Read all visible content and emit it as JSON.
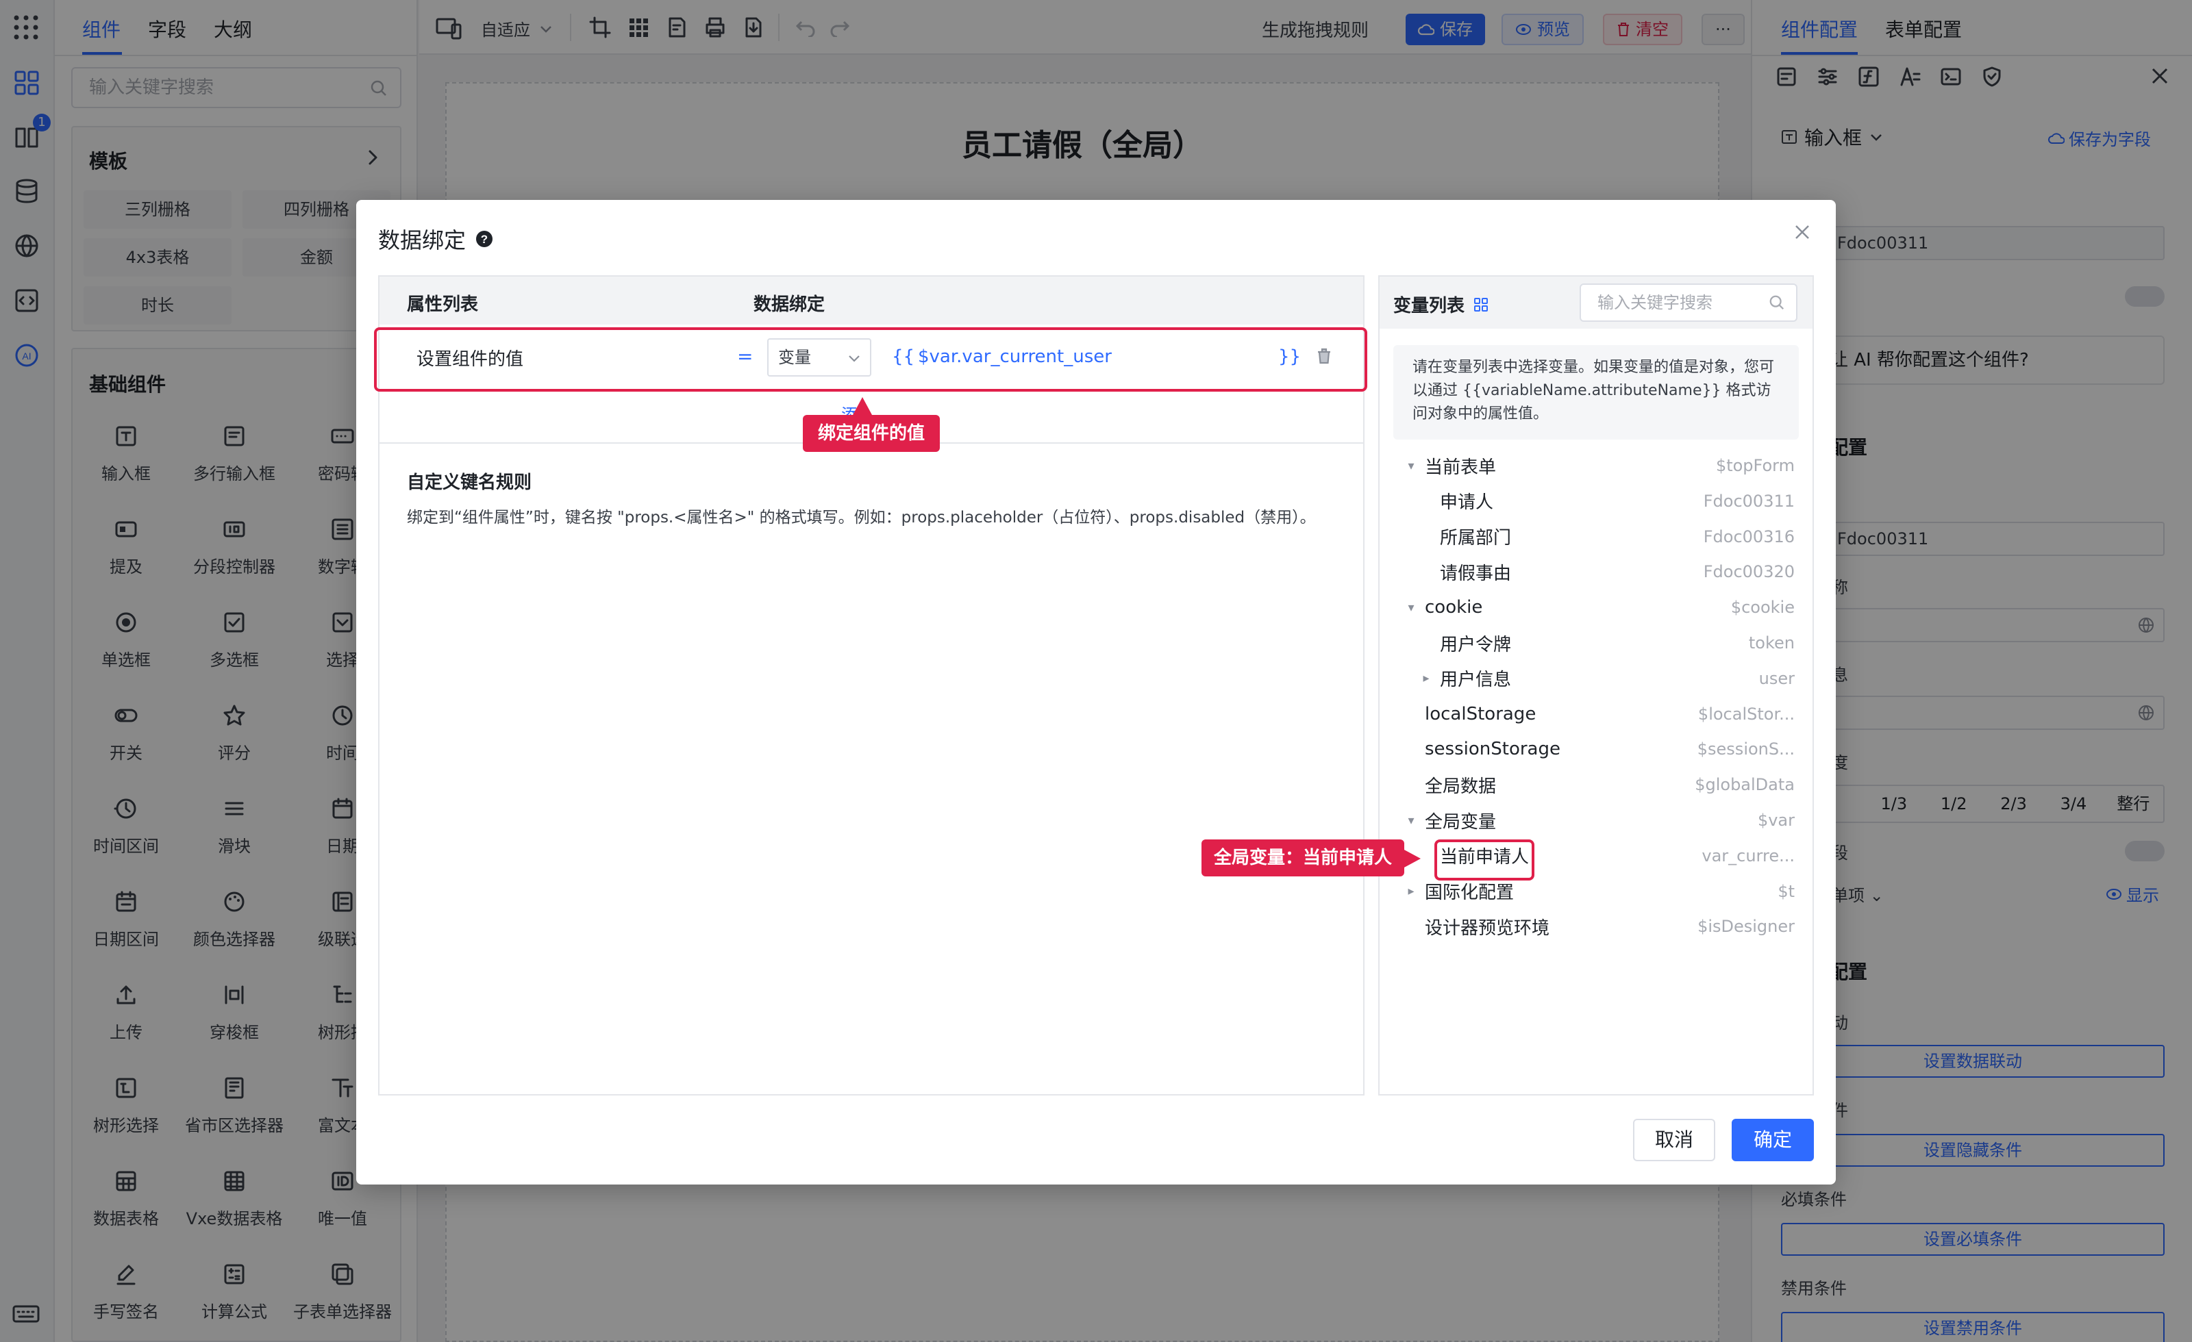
{
  "left_tabs": [
    "组件",
    "字段",
    "大纲"
  ],
  "left_search_placeholder": "输入关键字搜索",
  "template_section": {
    "title": "模板",
    "items": [
      "三列栅格",
      "四列栅格",
      "4x3表格",
      "金额",
      "时长"
    ]
  },
  "basic_section": {
    "title": "基础组件",
    "items": [
      {
        "label": "输入框",
        "icon": "input-icon"
      },
      {
        "label": "多行输入框",
        "icon": "textarea-icon"
      },
      {
        "label": "密码输",
        "icon": "password-icon"
      },
      {
        "label": "提及",
        "icon": "mention-icon"
      },
      {
        "label": "分段控制器",
        "icon": "segmented-icon"
      },
      {
        "label": "数字输",
        "icon": "number-icon"
      },
      {
        "label": "单选框",
        "icon": "radio-icon"
      },
      {
        "label": "多选框",
        "icon": "checkbox-icon"
      },
      {
        "label": "选择",
        "icon": "select-icon"
      },
      {
        "label": "开关",
        "icon": "switch-icon"
      },
      {
        "label": "评分",
        "icon": "star-icon"
      },
      {
        "label": "时间",
        "icon": "clock-icon"
      },
      {
        "label": "时间区间",
        "icon": "time-range-icon"
      },
      {
        "label": "滑块",
        "icon": "slider-icon"
      },
      {
        "label": "日期",
        "icon": "calendar-icon"
      },
      {
        "label": "日期区间",
        "icon": "date-range-icon"
      },
      {
        "label": "颜色选择器",
        "icon": "palette-icon"
      },
      {
        "label": "级联选",
        "icon": "cascader-icon"
      },
      {
        "label": "上传",
        "icon": "upload-icon"
      },
      {
        "label": "穿梭框",
        "icon": "transfer-icon"
      },
      {
        "label": "树形控",
        "icon": "tree-icon"
      },
      {
        "label": "树形选择",
        "icon": "tree-select-icon"
      },
      {
        "label": "省市区选择器",
        "icon": "region-icon"
      },
      {
        "label": "富文本",
        "icon": "richtext-icon"
      },
      {
        "label": "数据表格",
        "icon": "table-icon"
      },
      {
        "label": "Vxe数据表格",
        "icon": "vxe-table-icon"
      },
      {
        "label": "唯一值",
        "icon": "id-icon"
      },
      {
        "label": "手写签名",
        "icon": "signature-icon"
      },
      {
        "label": "计算公式",
        "icon": "formula-icon"
      },
      {
        "label": "子表单选择器",
        "icon": "subform-icon"
      }
    ]
  },
  "toolbar": {
    "responsive_label": "自适应",
    "generate_rule": "生成拖拽规则",
    "save": "保存",
    "preview": "预览",
    "clear": "清空",
    "more": "···"
  },
  "form_title": "员工请假（全局）",
  "right_panel": {
    "tabs": [
      "组件配置",
      "表单配置"
    ],
    "component_type": "输入框",
    "save_as_field": "保存为字段",
    "field_id": "Fdoc00311",
    "ai_prompt": "让 AI 帮你配置这个组件?",
    "config_heading": "配置",
    "field_id2": "Fdoc00311",
    "width_options": [
      "1/3",
      "1/2",
      "2/3",
      "3/4",
      "整行"
    ],
    "show_label": "显示",
    "single_item": "单项",
    "advanced_heading": "配置",
    "btn_linkage": "设置数据联动",
    "btn_hidden": "设置隐藏条件",
    "required_label": "必填条件",
    "btn_required": "设置必填条件",
    "disabled_label": "禁用条件",
    "btn_disabled": "设置禁用条件",
    "partial_labels": [
      "称",
      "息",
      "度",
      "段",
      "动",
      "件"
    ]
  },
  "dialog": {
    "title": "数据绑定",
    "help_icon": "question-circle-icon",
    "col_props": "属性列表",
    "col_binding": "数据绑定",
    "row": {
      "property": "设置组件的值",
      "equals": "=",
      "type": "变量",
      "open_brace": "{{",
      "expression": "$var.var_current_user",
      "close_brace": "}}"
    },
    "add_label": "添",
    "rules_title": "自定义键名规则",
    "rules_text": "绑定到“组件属性”时，键名按 \"props.<属性名>\" 的格式填写。例如：props.placeholder（占位符）、props.disabled（禁用）。",
    "var_list_title": "变量列表",
    "var_search_placeholder": "输入关键字搜索",
    "var_hint": "请在变量列表中选择变量。如果变量的值是对象，您可以通过 {{variableName.attributeName}} 格式访问对象中的属性值。",
    "variables": [
      {
        "name": "当前表单",
        "path": "$topForm",
        "toggle": "▾",
        "level": 0
      },
      {
        "name": "申请人",
        "path": "Fdoc00311",
        "toggle": "",
        "level": 1
      },
      {
        "name": "所属部门",
        "path": "Fdoc00316",
        "toggle": "",
        "level": 1
      },
      {
        "name": "请假事由",
        "path": "Fdoc00320",
        "toggle": "",
        "level": 1
      },
      {
        "name": "cookie",
        "path": "$cookie",
        "toggle": "▾",
        "level": 0
      },
      {
        "name": "用户令牌",
        "path": "token",
        "toggle": "",
        "level": 1
      },
      {
        "name": "用户信息",
        "path": "user",
        "toggle": "▸",
        "level": 1
      },
      {
        "name": "localStorage",
        "path": "$localStor...",
        "toggle": "",
        "level": 0
      },
      {
        "name": "sessionStorage",
        "path": "$sessionS...",
        "toggle": "",
        "level": 0
      },
      {
        "name": "全局数据",
        "path": "$globalData",
        "toggle": "",
        "level": 0
      },
      {
        "name": "全局变量",
        "path": "$var",
        "toggle": "▾",
        "level": 0
      },
      {
        "name": "当前申请人",
        "path": "var_curre...",
        "toggle": "",
        "level": 1
      },
      {
        "name": "国际化配置",
        "path": "$t",
        "toggle": "▸",
        "level": 0
      },
      {
        "name": "设计器预览环境",
        "path": "$isDesigner",
        "toggle": "",
        "level": 0
      }
    ],
    "cancel": "取消",
    "confirm": "确定"
  },
  "callouts": {
    "bind_value": "绑定组件的值",
    "global_var": "全局变量：当前申请人"
  },
  "badge_count": "1",
  "colors": {
    "primary": "#2f6bff",
    "danger": "#e0204a"
  }
}
